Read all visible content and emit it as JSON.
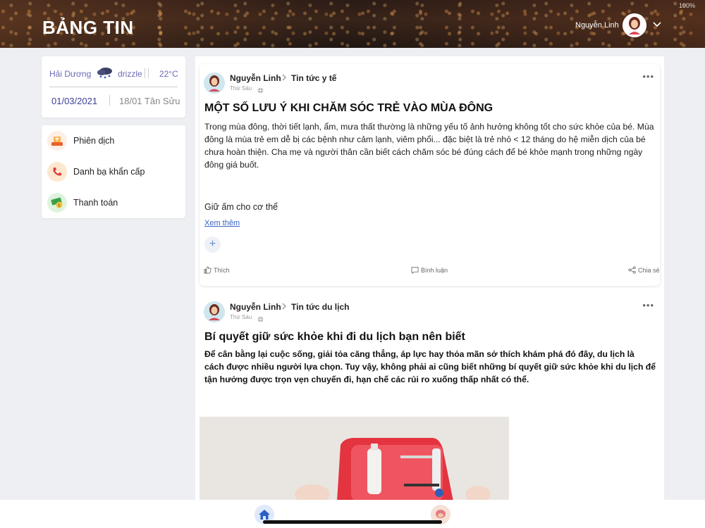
{
  "header": {
    "title": "BẢNG TIN",
    "user_name": "Nguyễn Linh",
    "status_text": "100%"
  },
  "weather": {
    "city": "Hải Dương",
    "condition": "drizzle",
    "temperature": "22°C",
    "date": "01/03/2021",
    "lunar_date": "18/01 Tân Sửu",
    "icon": "cloud-rain-icon"
  },
  "sidebar": {
    "items": [
      {
        "label": "Phiên dịch",
        "icon": "translate-icon"
      },
      {
        "label": "Danh bạ khẩn cấp",
        "icon": "phone-icon"
      },
      {
        "label": "Thanh toán",
        "icon": "money-icon"
      }
    ]
  },
  "posts": [
    {
      "author": "Nguyễn Linh",
      "category": "Tin tức y tế",
      "day": "Thứ Sáu",
      "title": "MỘT SỐ LƯU Ý KHI CHĂM SÓC TRẺ VÀO MÙA ĐÔNG",
      "body": "Trong mùa đông, thời tiết lạnh, ẩm, mưa thất thường là những yếu tố ảnh hưởng không tốt cho sức khỏe của bé. Mùa đông là mùa trẻ em dễ bị các bệnh như cảm lạnh, viêm phổi... đặc biệt là trẻ nhỏ < 12 tháng do hệ miễn dịch của bé chưa hoàn thiện. Cha mẹ và người thân cần biết cách chăm sóc bé đúng cách để bé khỏe mạnh trong những ngày đông giá buốt.",
      "subheading": "Giữ ấm cho cơ thể",
      "see_more": "Xem thêm",
      "like_label": "Thích",
      "comment_label": "Bình luận",
      "share_label": "Chia sẻ"
    },
    {
      "author": "Nguyễn Linh",
      "category": "Tin tức du lịch",
      "day": "Thứ Sáu",
      "title": "Bí quyết giữ sức khỏe khi đi du lịch bạn nên biết",
      "body": "Để cân bằng lại cuộc sống, giải tỏa căng thẳng, áp lực hay thỏa mãn sở thích khám phá đó đây, du lịch là cách được nhiều người lựa chọn. Tuy vậy, không phải ai cũng biết những bí quyết giữ sức khỏe khi du lịch để tận hưởng được trọn vẹn chuyến đi, hạn chế các rủi ro xuống thấp nhất có thể."
    }
  ],
  "bottom_nav": {
    "items": [
      {
        "icon": "home-icon"
      },
      {
        "icon": "profile-avatar-icon"
      }
    ]
  },
  "colors": {
    "accent": "#3d3d99",
    "link": "#3a64c4",
    "weather_text": "#6a6ab8"
  }
}
